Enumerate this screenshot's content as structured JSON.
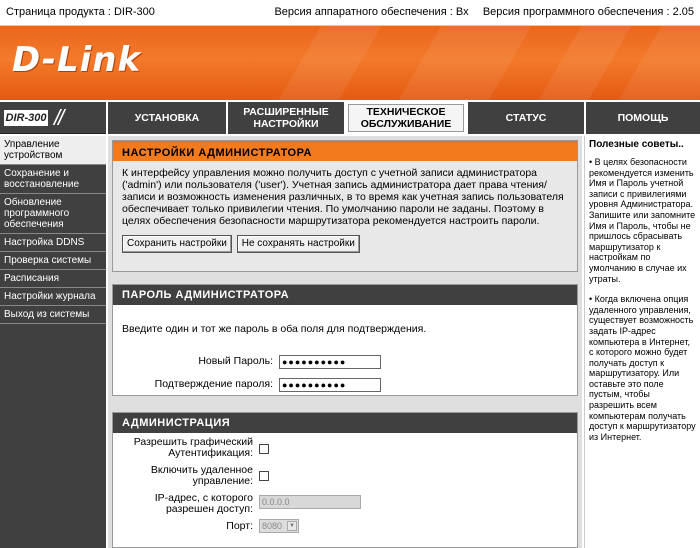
{
  "topbar": {
    "product_label": "Страница продукта :",
    "product_value": "DIR-300",
    "hw_label": "Версия аппаратного обеспечения :",
    "hw_value": "Bx",
    "fw_label": "Версия программного обеспечения :",
    "fw_value": "2.05"
  },
  "brand": {
    "logo_text": "D-Link",
    "model_badge": "DIR-300"
  },
  "nav": {
    "setup": "УСТАНОВКА",
    "advanced_1": "РАСШИРЕННЫЕ",
    "advanced_2": "НАСТРОЙКИ",
    "maintenance_1": "ТЕХНИЧЕСКОЕ",
    "maintenance_2": "ОБСЛУЖИВАНИЕ",
    "status": "СТАТУС",
    "help": "ПОМОЩЬ"
  },
  "sidebar": {
    "items": [
      {
        "label": "Управление устройством"
      },
      {
        "label": "Сохранение и восстановление"
      },
      {
        "label": "Обновление программного обеспечения"
      },
      {
        "label": "Настройка DDNS"
      },
      {
        "label": "Проверка системы"
      },
      {
        "label": "Расписания"
      },
      {
        "label": "Настройки журнала"
      },
      {
        "label": "Выход из системы"
      }
    ]
  },
  "admin_settings": {
    "title": "НАСТРОЙКИ АДМИНИСТРАТОРА",
    "line1": "К интерфейсу управления можно получить доступ с учетной записи администратора",
    "line2": "('admin') или пользователя ('user'). Учетная запись администратора дает права чтения/",
    "line3": "записи и возможность изменения различных, в то время как учетная запись пользователя",
    "line4": "обеспечивает только привилегии чтения. По умолчанию пароли не заданы. Поэтому в",
    "line5": "целях обеспечения безопасности маршрутизатора рекомендуется настроить пароли.",
    "save_label": "Сохранить настройки",
    "dont_save_label": "Не сохранять настройки"
  },
  "password": {
    "title": "ПАРОЛЬ АДМИНИСТРАТОРА",
    "instruction": "Введите один и тот же пароль в оба поля для подтверждения.",
    "new_label": "Новый Пароль:",
    "new_value": "●●●●●●●●●●",
    "confirm_label": "Подтверждение пароля:",
    "confirm_value": "●●●●●●●●●●"
  },
  "administration": {
    "title": "АДМИНИСТРАЦИЯ",
    "gui_auth_1": "Разрешить графический",
    "gui_auth_2": "Аутентификация:",
    "remote_1": "Включить удаленное",
    "remote_2": "управление:",
    "ip_1": "IP-адрес, с которого",
    "ip_2": "разрешен доступ:",
    "ip_value": "0.0.0.0",
    "port_label": "Порт:",
    "port_value": "8080"
  },
  "tips": {
    "heading": "Полезные советы..",
    "tip1": "• В целях безопасности рекомендуется изменить Имя и Пароль учетной записи с привилегиями уровня Администратора. Запишите или запомните Имя и Пароль, чтобы не пришлось сбрасывать маршрутизатор к настройкам по умолчанию в случае их утраты.",
    "tip2": "• Когда включена опция удаленного управления, существует возможность задать IP-адрес компьютера в Интернет, с которого можно будет получать доступ к маршрутизатору. Или оставьте это поле пустым, чтобы разрешить всем компьютерам получать доступ к маршрутизатору из Интернет."
  },
  "colors": {
    "accent": "#f37a1d",
    "nav_bg": "#404040"
  }
}
